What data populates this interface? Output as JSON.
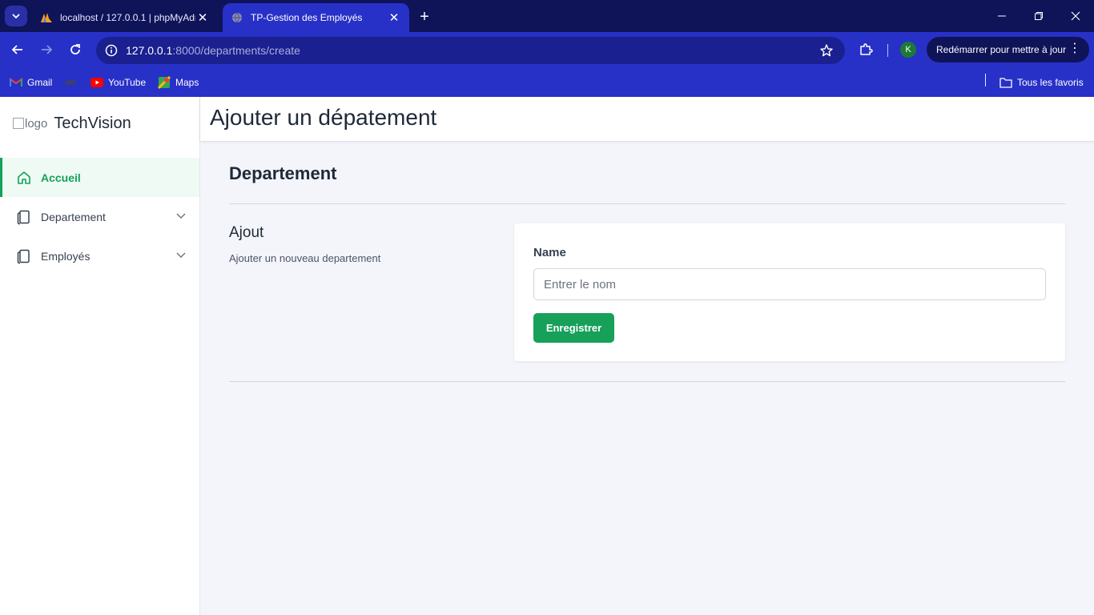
{
  "browser": {
    "tabs": [
      {
        "title": "localhost / 127.0.0.1 | phpMyAdmin",
        "active": false
      },
      {
        "title": "TP-Gestion des Employés",
        "active": true
      }
    ],
    "address": {
      "host": "127.0.0.1",
      "rest": ":8000/departments/create"
    },
    "profile_initial": "K",
    "update_button": "Redémarrer pour mettre à jour",
    "bookmarks": [
      "Gmail",
      "YouTube",
      "Maps"
    ],
    "all_bookmarks": "Tous les favoris"
  },
  "sidebar": {
    "logo_alt": "logo",
    "brand": "TechVision",
    "items": [
      {
        "label": "Accueil",
        "active": true
      },
      {
        "label": "Departement",
        "active": false
      },
      {
        "label": "Employés",
        "active": false
      }
    ]
  },
  "header": {
    "title": "Ajouter un dépatement"
  },
  "main": {
    "section_title": "Departement",
    "form_heading": "Ajout",
    "form_description": "Ajouter un nouveau departement",
    "field_label": "Name",
    "field_placeholder": "Entrer le nom",
    "field_value": "",
    "submit_label": "Enregistrer"
  },
  "colors": {
    "accent": "#16a05a",
    "browser_frame": "#2731c8",
    "browser_tabbar": "#0f1358"
  }
}
